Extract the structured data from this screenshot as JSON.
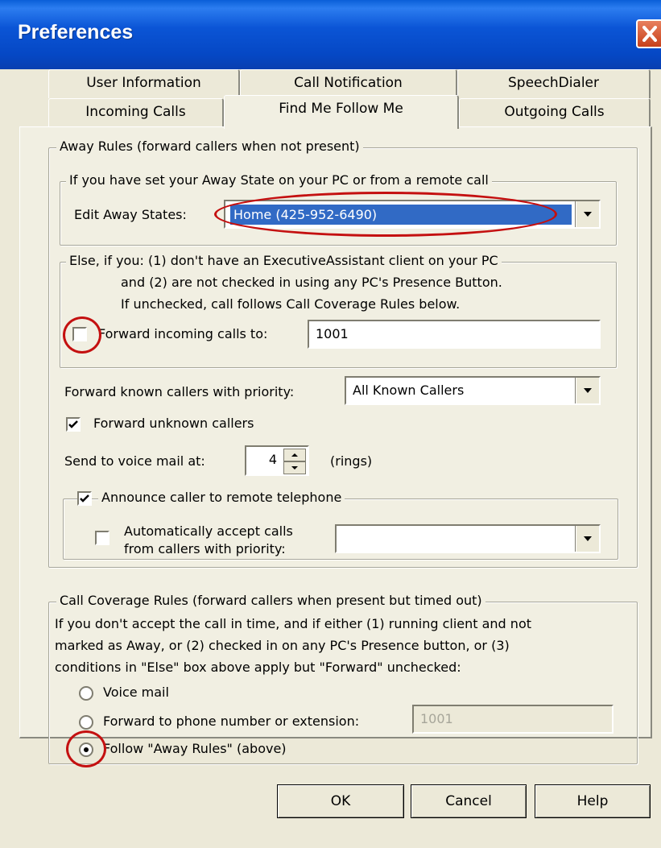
{
  "window": {
    "title": "Preferences"
  },
  "tabs": {
    "row1": [
      "User Information",
      "Call Notification",
      "SpeechDialer"
    ],
    "row2": [
      "Incoming Calls",
      "Find Me Follow Me",
      "Outgoing Calls"
    ],
    "active": "Find Me Follow Me"
  },
  "away_rules": {
    "legend": "Away Rules (forward callers when not present)",
    "away_state_group": {
      "legend": "If you have set your Away State on your PC or from a remote call",
      "edit_label": "Edit Away States:",
      "edit_value": "Home (425-952-6490)"
    },
    "else_group": {
      "legend": "Else, if you: (1) don't have an ExecutiveAssistant client on your PC",
      "line2": "and (2) are not checked in using any PC's Presence Button.",
      "line3": "If unchecked, call follows Call Coverage Rules below.",
      "forward_label": "Forward incoming calls to:",
      "forward_checked": false,
      "forward_value": "1001"
    },
    "known_callers_label": "Forward known callers with priority:",
    "known_callers_value": "All Known Callers",
    "unknown_label": "Forward unknown callers",
    "unknown_checked": true,
    "voicemail_label": "Send to voice mail at:",
    "voicemail_rings": "4",
    "rings_label": "(rings)",
    "announce": {
      "legend": "Announce caller to remote telephone",
      "checked": true,
      "auto_accept_line1": "Automatically accept calls",
      "auto_accept_line2": "from callers with priority:",
      "auto_accept_checked": false,
      "auto_accept_value": ""
    }
  },
  "coverage": {
    "legend": "Call Coverage Rules (forward callers when present but timed out)",
    "line1": "If you don't accept the call in time, and if either (1) running client and not",
    "line2": "marked as Away, or (2) checked in on any PC's Presence button, or (3)",
    "line3": "conditions in \"Else\" box above apply but \"Forward\" unchecked:",
    "options": [
      "Voice mail",
      "Forward to phone number or extension:",
      "Follow \"Away Rules\" (above)"
    ],
    "selected_index": 2,
    "forward_value": "1001"
  },
  "buttons": {
    "ok": "OK",
    "cancel": "Cancel",
    "help": "Help"
  },
  "colors": {
    "titlebar": "#0b55d6",
    "dialog": "#ece9d8",
    "panel": "#f1efe2",
    "highlight": "#316ac5",
    "annotation": "#c41010"
  },
  "icons": {
    "close": "close-icon",
    "dropdown": "chevron-down-icon",
    "spin_up": "arrow-up-icon",
    "spin_down": "arrow-down-icon"
  }
}
